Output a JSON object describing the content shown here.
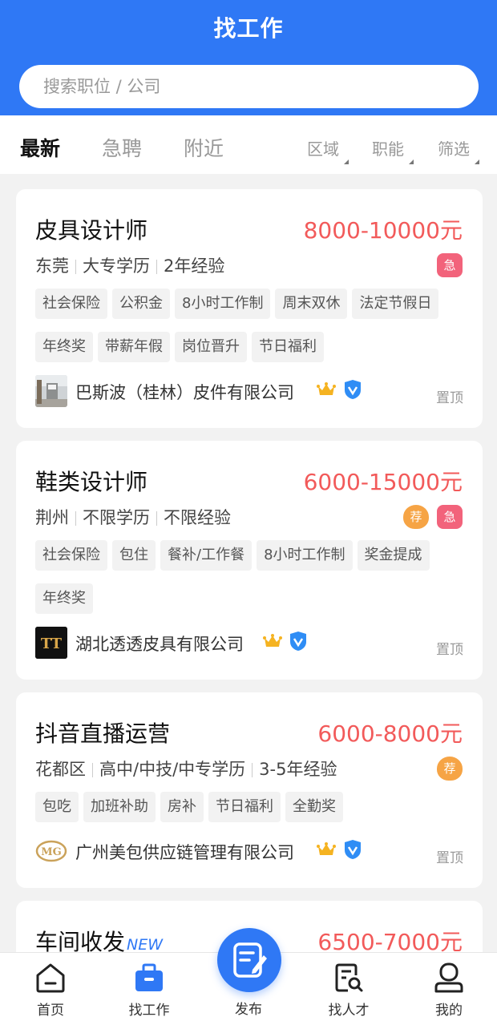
{
  "header": {
    "title": "找工作"
  },
  "search": {
    "placeholder": "搜索职位 / 公司",
    "value": ""
  },
  "filters": {
    "tabs": [
      "最新",
      "急聘",
      "附近"
    ],
    "selects": [
      "区域",
      "职能",
      "筛选"
    ]
  },
  "jobs": [
    {
      "title": "皮具设计师",
      "salary": "8000-10000元",
      "location": "东莞",
      "education": "大专学历",
      "experience": "2年经验",
      "badges": [
        "急"
      ],
      "tags": [
        "社会保险",
        "公积金",
        "8小时工作制",
        "周末双休",
        "法定节假日",
        "年终奖",
        "带薪年假",
        "岗位晋升",
        "节日福利"
      ],
      "company": "巴斯波（桂林）皮件有限公司",
      "pin_label": "置顶"
    },
    {
      "title": "鞋类设计师",
      "salary": "6000-15000元",
      "location": "荆州",
      "education": "不限学历",
      "experience": "不限经验",
      "badges": [
        "荐",
        "急"
      ],
      "tags": [
        "社会保险",
        "包住",
        "餐补/工作餐",
        "8小时工作制",
        "奖金提成",
        "年终奖"
      ],
      "company": "湖北透透皮具有限公司",
      "logo_text": "TT",
      "pin_label": "置顶"
    },
    {
      "title": "抖音直播运营",
      "salary": "6000-8000元",
      "location": "花都区",
      "education": "高中/中技/中专学历",
      "experience": "3-5年经验",
      "badges": [
        "荐"
      ],
      "tags": [
        "包吃",
        "加班补助",
        "房补",
        "节日福利",
        "全勤奖"
      ],
      "company": "广州美包供应链管理有限公司",
      "logo_text": "MG",
      "pin_label": "置顶"
    },
    {
      "title": "车间收发",
      "new_label": "NEW",
      "salary": "6500-7000元"
    }
  ],
  "tabbar": {
    "items": [
      "首页",
      "找工作",
      "发布",
      "找人才",
      "我的"
    ],
    "active": "找工作"
  },
  "colors": {
    "primary": "#2f78f5",
    "salary": "#f25a5a",
    "urgent": "#f2637b",
    "recommend": "#f6a445"
  }
}
